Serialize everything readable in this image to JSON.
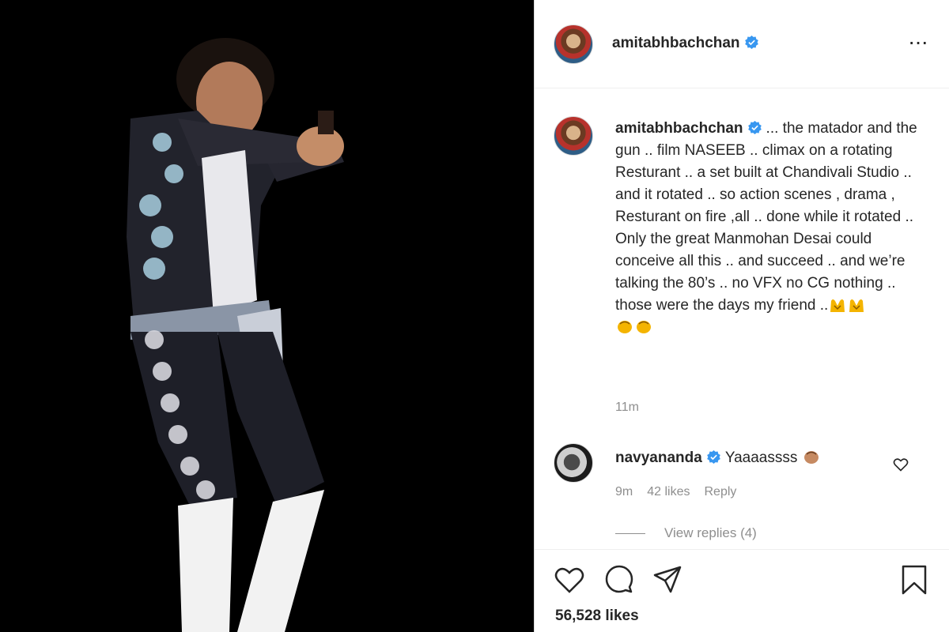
{
  "post": {
    "username": "amitabhbachchan",
    "more_icon": "more-horizontal-icon",
    "verified_color": "#3897f0"
  },
  "caption": {
    "username": "amitabhbachchan",
    "text": "... the matador and the gun .. film NASEEB .. climax on a rotating Resturant .. a set built at Chandivali Studio .. and it rotated .. so action scenes , drama , Resturant on fire ,all .. done while it rotated ..\nOnly the great Manmohan Desai could conceive all this .. and succeed .. and we’re talking the 80’s .. no VFX no CG nothing ..\nthose were the days my friend ..",
    "emojis": [
      "raising-hands-emoji",
      "raising-hands-emoji",
      "clapping-hands-emoji",
      "clapping-hands-emoji"
    ],
    "time": "11m"
  },
  "comment": {
    "username": "navyananda",
    "text": "Yaaaassss",
    "emoji": "clapping-hand-emoji",
    "time": "9m",
    "likes": "42 likes",
    "reply": "Reply",
    "view_replies": "View replies (4)"
  },
  "actions": {
    "icons": [
      "heart-icon",
      "comment-icon",
      "share-icon",
      "bookmark-icon"
    ],
    "likes": "56,528 likes"
  }
}
